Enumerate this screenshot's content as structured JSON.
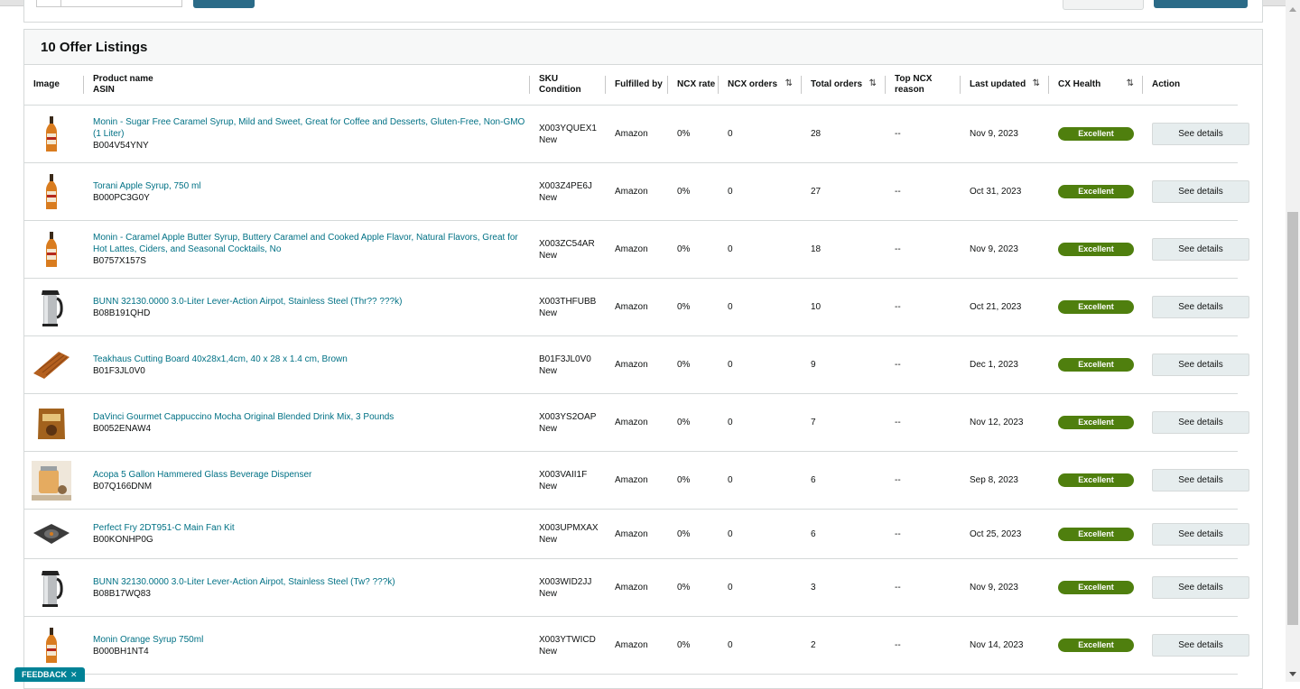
{
  "panel": {
    "title": "10 Offer Listings"
  },
  "columns": {
    "image": "Image",
    "product_name": "Product name",
    "asin": "ASIN",
    "sku": "SKU",
    "condition": "Condition",
    "fulfilled_by": "Fulfilled by",
    "ncx_rate": "NCX rate",
    "ncx_orders": "NCX orders",
    "total_orders": "Total orders",
    "top_ncx_reason_1": "Top NCX",
    "top_ncx_reason_2": "reason",
    "last_updated": "Last updated",
    "cx_health": "CX Health",
    "action": "Action",
    "sort_icon": "⇅"
  },
  "rows": [
    {
      "name": "Monin - Sugar Free Caramel Syrup, Mild and Sweet, Great for Coffee and Desserts, Gluten-Free, Non-GMO (1 Liter)",
      "asin": "B004V54YNY",
      "sku": "X003YQUEX1",
      "condition": "New",
      "fulfilled": "Amazon",
      "ncx_rate": "0%",
      "ncx_orders": "0",
      "total_orders": "28",
      "reason": "--",
      "updated": "Nov 9, 2023",
      "health": "Excellent",
      "action": "See details",
      "icon": "syrup-bottle-icon"
    },
    {
      "name": "Torani Apple Syrup, 750 ml",
      "asin": "B000PC3G0Y",
      "sku": "X003Z4PE6J",
      "condition": "New",
      "fulfilled": "Amazon",
      "ncx_rate": "0%",
      "ncx_orders": "0",
      "total_orders": "27",
      "reason": "--",
      "updated": "Oct 31, 2023",
      "health": "Excellent",
      "action": "See details",
      "icon": "syrup-bottle-icon"
    },
    {
      "name": "Monin - Caramel Apple Butter Syrup, Buttery Caramel and Cooked Apple Flavor, Natural Flavors, Great for Hot Lattes, Ciders, and Seasonal Cocktails, No",
      "asin": "B0757X157S",
      "sku": "X003ZC54AR",
      "condition": "New",
      "fulfilled": "Amazon",
      "ncx_rate": "0%",
      "ncx_orders": "0",
      "total_orders": "18",
      "reason": "--",
      "updated": "Nov 9, 2023",
      "health": "Excellent",
      "action": "See details",
      "icon": "syrup-bottle-icon"
    },
    {
      "name": "BUNN 32130.0000 3.0-Liter Lever-Action Airpot, Stainless Steel (Thr?? ???k)",
      "asin": "B08B191QHD",
      "sku": "X003THFUBB",
      "condition": "New",
      "fulfilled": "Amazon",
      "ncx_rate": "0%",
      "ncx_orders": "0",
      "total_orders": "10",
      "reason": "--",
      "updated": "Oct 21, 2023",
      "health": "Excellent",
      "action": "See details",
      "icon": "airpot-icon"
    },
    {
      "name": "Teakhaus Cutting Board 40x28x1,4cm, 40 x 28 x 1.4 cm, Brown",
      "asin": "B01F3JL0V0",
      "sku": "B01F3JL0V0",
      "condition": "New",
      "fulfilled": "Amazon",
      "ncx_rate": "0%",
      "ncx_orders": "0",
      "total_orders": "9",
      "reason": "--",
      "updated": "Dec 1, 2023",
      "health": "Excellent",
      "action": "See details",
      "icon": "cutting-board-icon"
    },
    {
      "name": "DaVinci Gourmet Cappuccino Mocha Original Blended Drink Mix, 3 Pounds",
      "asin": "B0052ENAW4",
      "sku": "X003YS2OAP",
      "condition": "New",
      "fulfilled": "Amazon",
      "ncx_rate": "0%",
      "ncx_orders": "0",
      "total_orders": "7",
      "reason": "--",
      "updated": "Nov 12, 2023",
      "health": "Excellent",
      "action": "See details",
      "icon": "drink-mix-bag-icon"
    },
    {
      "name": "Acopa 5 Gallon Hammered Glass Beverage Dispenser",
      "asin": "B07Q166DNM",
      "sku": "X003VAII1F",
      "condition": "New",
      "fulfilled": "Amazon",
      "ncx_rate": "0%",
      "ncx_orders": "0",
      "total_orders": "6",
      "reason": "--",
      "updated": "Sep 8, 2023",
      "health": "Excellent",
      "action": "See details",
      "icon": "beverage-dispenser-icon"
    },
    {
      "name": "Perfect Fry 2DT951-C Main Fan Kit",
      "asin": "B00KONHP0G",
      "sku": "X003UPMXAX",
      "condition": "New",
      "fulfilled": "Amazon",
      "ncx_rate": "0%",
      "ncx_orders": "0",
      "total_orders": "6",
      "reason": "--",
      "updated": "Oct 25, 2023",
      "health": "Excellent",
      "action": "See details",
      "icon": "fan-kit-icon"
    },
    {
      "name": "BUNN 32130.0000 3.0-Liter Lever-Action Airpot, Stainless Steel (Tw? ???k)",
      "asin": "B08B17WQ83",
      "sku": "X003WID2JJ",
      "condition": "New",
      "fulfilled": "Amazon",
      "ncx_rate": "0%",
      "ncx_orders": "0",
      "total_orders": "3",
      "reason": "--",
      "updated": "Nov 9, 2023",
      "health": "Excellent",
      "action": "See details",
      "icon": "airpot-icon"
    },
    {
      "name": "Monin Orange Syrup 750ml",
      "asin": "B000BH1NT4",
      "sku": "X003YTWICD",
      "condition": "New",
      "fulfilled": "Amazon",
      "ncx_rate": "0%",
      "ncx_orders": "0",
      "total_orders": "2",
      "reason": "--",
      "updated": "Nov 14, 2023",
      "health": "Excellent",
      "action": "See details",
      "icon": "syrup-bottle-icon"
    }
  ],
  "feedback": {
    "label": "FEEDBACK",
    "close": "✕"
  },
  "colors": {
    "health_excellent": "#4f7f0e",
    "link": "#007185",
    "feedback": "#008296"
  }
}
